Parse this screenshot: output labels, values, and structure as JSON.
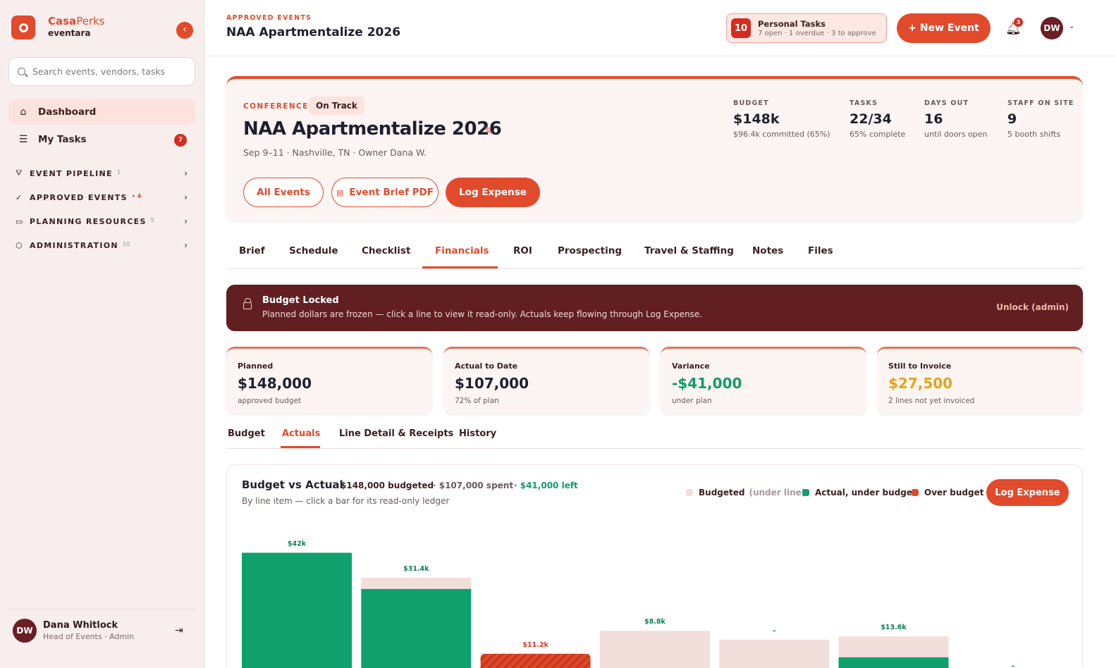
{
  "sidebar": {
    "brand_name_a": "Casa",
    "brand_name_b": "Perks",
    "brand_sub": "eventara",
    "search_placeholder": "Search events, vendors, tasks",
    "nav": [
      {
        "label": "Dashboard",
        "icon": "home-icon"
      },
      {
        "label": "My Tasks",
        "icon": "checklist-icon",
        "badge": "7"
      }
    ],
    "sections": [
      {
        "title": "EVENT PIPELINE",
        "count": "1",
        "icon": "filter-icon"
      },
      {
        "title": "APPROVED EVENTS",
        "count": "• 4",
        "icon": "check-circle-icon"
      },
      {
        "title": "PLANNING RESOURCES",
        "count": "5",
        "icon": "folder-icon"
      },
      {
        "title": "ADMINISTRATION",
        "count": "10",
        "icon": "shield-icon"
      }
    ],
    "user": {
      "initials": "DW",
      "name": "Dana Whitlock",
      "role": "Head of Events · Admin"
    }
  },
  "topbar": {
    "crumb": "APPROVED EVENTS",
    "title": "NAA Apartmentalize 2026",
    "personal_tasks": {
      "count": "10",
      "title": "Personal Tasks",
      "sub": "7 open · 1 overdue · 3 to approve"
    },
    "new_event": "+ New Event",
    "notifications": "3",
    "avatar": "DW"
  },
  "event": {
    "type": "CONFERENCE",
    "status": "On Track",
    "title": "NAA Apartmentalize 2026",
    "meta": "Sep 9–11 · Nashville, TN · Owner Dana W.",
    "buttons": {
      "all_events": "All Events",
      "brief_pdf": "Event Brief PDF",
      "log_expense": "Log Expense"
    },
    "stats": [
      {
        "label": "BUDGET",
        "value": "$148k",
        "sub": "$96.4k committed (65%)"
      },
      {
        "label": "TASKS",
        "value": "22/34",
        "sub": "65% complete"
      },
      {
        "label": "DAYS OUT",
        "value": "16",
        "sub": "until doors open"
      },
      {
        "label": "STAFF ON SITE",
        "value": "9",
        "sub": "5 booth shifts"
      }
    ]
  },
  "tabs": [
    "Brief",
    "Schedule",
    "Checklist",
    "Financials",
    "ROI",
    "Prospecting",
    "Travel & Staffing",
    "Notes",
    "Files"
  ],
  "active_tab": "Financials",
  "locked": {
    "title": "Budget Locked",
    "sub": "Planned dollars are frozen — click a line to view it read-only. Actuals keep flowing through Log Expense.",
    "action": "Unlock (admin)"
  },
  "kpis": [
    {
      "label": "Planned",
      "value": "$148,000",
      "sub": "approved budget",
      "color": "#1f1f2e"
    },
    {
      "label": "Actual to Date",
      "value": "$107,000",
      "sub": "72% of plan",
      "color": "#1f1f2e"
    },
    {
      "label": "Variance",
      "value": "-$41,000",
      "sub": "under plan",
      "color": "#109b6a"
    },
    {
      "label": "Still to Invoice",
      "value": "$27,500",
      "sub": "2 lines not yet invoiced",
      "color": "#e8a412"
    }
  ],
  "subtabs": [
    "Budget",
    "Actuals",
    "Line Detail & Receipts",
    "History"
  ],
  "active_subtab": "Actuals",
  "chart": {
    "title": "Budget vs Actual",
    "budgeted": "$148,000 budgeted",
    "spent": "· $107,000 spent",
    "left": "· $41,000 left",
    "subtitle": "By line item — click a bar for its read-only ledger",
    "legend": {
      "budgeted": "Budgeted",
      "budgeted_note": "(under line)",
      "under": "Actual, under budget",
      "over": "Over budget"
    },
    "button": "Log Expense",
    "colors": {
      "budget": "#f2dfdb",
      "under": "#10a06d",
      "over": "#e04a2c",
      "label_under": "#0e7f55",
      "label_over": "#d83a22"
    }
  },
  "chart_data": {
    "type": "bar",
    "categories": [
      "",
      "",
      "",
      "",
      "",
      "",
      ""
    ],
    "series": [
      {
        "name": "Budgeted",
        "values": [
          42,
          33.5,
          8,
          15.5,
          12.5,
          13.6,
          0.5
        ]
      },
      {
        "name": "Actual, under budget",
        "values": [
          42,
          29.7,
          0,
          0,
          0,
          6.5,
          0
        ]
      },
      {
        "name": "Over budget",
        "values": [
          0,
          0,
          11.2,
          0,
          0,
          0,
          0
        ]
      }
    ],
    "labels": [
      "$42k",
      "$31.4k",
      "$11.2k",
      "$8.8k",
      "–",
      "$13.6k",
      "–"
    ],
    "label_status": [
      "under",
      "under",
      "over",
      "under",
      "under",
      "under",
      "under"
    ]
  }
}
